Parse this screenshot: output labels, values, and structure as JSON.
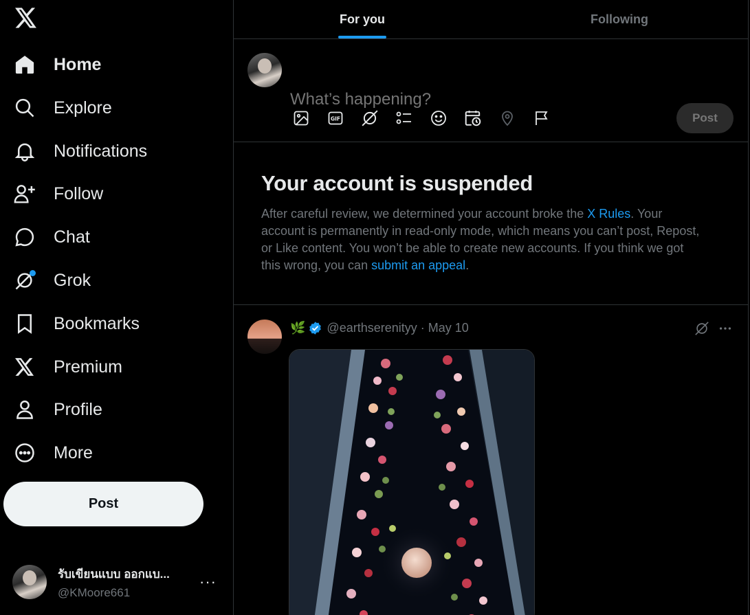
{
  "sidebar": {
    "items": [
      {
        "label": "Home",
        "icon": "home-icon",
        "active": true
      },
      {
        "label": "Explore",
        "icon": "search-icon"
      },
      {
        "label": "Notifications",
        "icon": "bell-icon"
      },
      {
        "label": "Follow",
        "icon": "add-person-icon"
      },
      {
        "label": "Chat",
        "icon": "chat-bubble-icon"
      },
      {
        "label": "Grok",
        "icon": "grok-icon",
        "badge": true
      },
      {
        "label": "Bookmarks",
        "icon": "bookmark-icon"
      },
      {
        "label": "Premium",
        "icon": "x-logo-icon"
      },
      {
        "label": "Profile",
        "icon": "person-icon"
      },
      {
        "label": "More",
        "icon": "more-circle-icon"
      }
    ],
    "post_label": "Post",
    "account": {
      "name": "รับเขียนแบบ ออกแบ...",
      "handle": "@KMoore661"
    }
  },
  "tabs": [
    {
      "label": "For you",
      "active": true
    },
    {
      "label": "Following",
      "active": false
    }
  ],
  "composer": {
    "placeholder": "What’s happening?",
    "post_label": "Post",
    "tools": [
      "image-icon",
      "gif-icon",
      "grok-icon",
      "poll-icon",
      "emoji-icon",
      "schedule-icon",
      "location-icon",
      "flag-icon"
    ]
  },
  "suspended": {
    "title": "Your account is suspended",
    "text_1": "After careful review, we determined your account broke the ",
    "link_rules": "X Rules",
    "text_2": ". Your account is permanently in read-only mode, which means you can’t post, Repost, or Like content. You won’t be able to create new accounts. If you think we got this wrong, you can ",
    "link_appeal": "submit an appeal",
    "text_3": "."
  },
  "post": {
    "emoji": "🌿",
    "handle": "@earthserenityy",
    "separator": "·",
    "date": "May 10"
  },
  "colors": {
    "accent": "#1d9bf0",
    "background": "#000000",
    "text": "#e7e9ea",
    "muted": "#71767b",
    "border": "#2f3336"
  }
}
